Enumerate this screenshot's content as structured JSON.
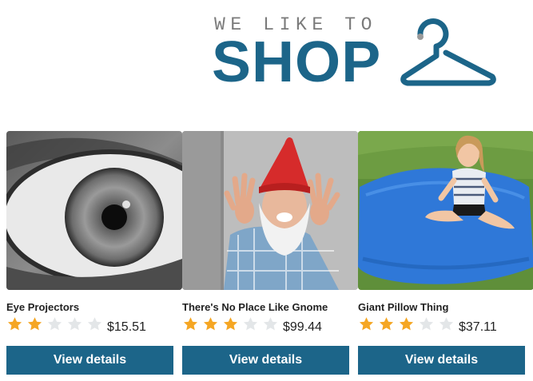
{
  "header": {
    "tagline": "WE LIKE TO",
    "brand": "SHOP",
    "logo_icon": "hanger-icon",
    "colors": {
      "brand": "#1c6589",
      "tagline": "#7b7b7b",
      "star_on": "#f5a623",
      "star_off": "#e3e6e8",
      "button": "#1c6589"
    }
  },
  "products": [
    {
      "name": "Eye Projectors",
      "rating": 2,
      "max_rating": 5,
      "price": "$15.51",
      "button_label": "View details",
      "image": "eye-closeup-photo"
    },
    {
      "name": "There's No Place Like Gnome",
      "rating": 3,
      "max_rating": 5,
      "price": "$99.44",
      "button_label": "View details",
      "image": "gnome-costume-photo"
    },
    {
      "name": "Giant Pillow Thing",
      "rating": 3,
      "max_rating": 5,
      "price": "$37.11",
      "button_label": "View details",
      "image": "giant-pillow-photo"
    }
  ]
}
